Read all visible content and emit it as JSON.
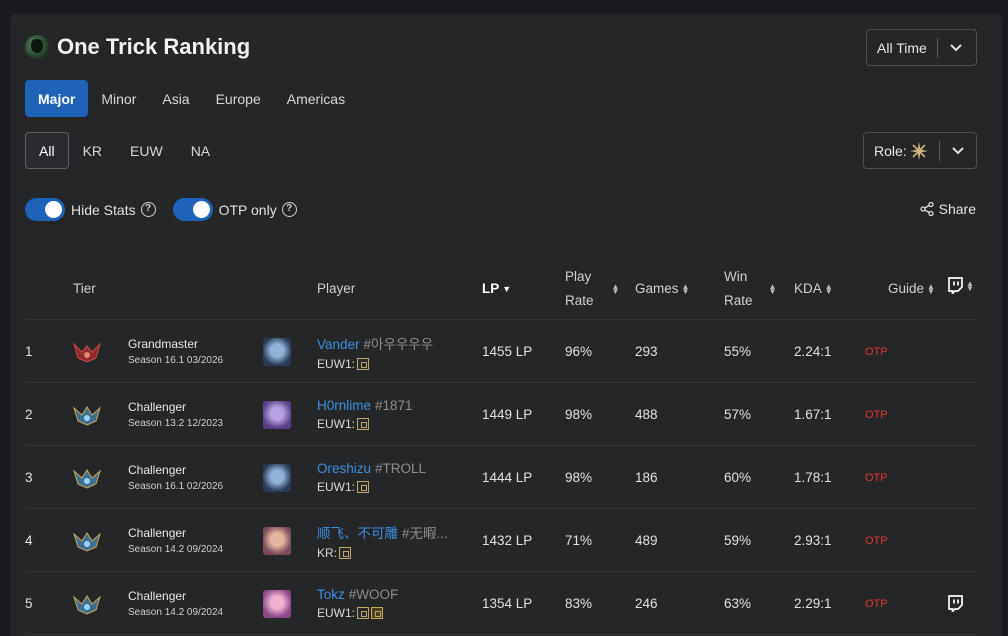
{
  "header": {
    "title": "One Trick Ranking",
    "time_filter": "All Time",
    "role_label": "Role:"
  },
  "tabs": [
    "Major",
    "Minor",
    "Asia",
    "Europe",
    "Americas"
  ],
  "regions": [
    "All",
    "KR",
    "EUW",
    "NA"
  ],
  "toggles": {
    "hide_stats": "Hide Stats",
    "otp_only": "OTP only"
  },
  "share": "Share",
  "columns": {
    "tier": "Tier",
    "player": "Player",
    "lp": "LP",
    "play_rate_1": "Play",
    "play_rate_2": "Rate",
    "games": "Games",
    "win_rate_1": "Win",
    "win_rate_2": "Rate",
    "kda": "KDA",
    "guide": "Guide"
  },
  "colors": {
    "accent": "#1f63b8",
    "link": "#3d8fe0",
    "otp": "#e23232"
  },
  "rows": [
    {
      "rank": "1",
      "tier": "Grandmaster",
      "season": "Season 16.1 03/2026",
      "name": "Vander",
      "tag": "#아우우우우",
      "server": "EUW1:",
      "lp": "1455 LP",
      "play_rate": "96%",
      "games": "293",
      "win_rate": "55%",
      "kda": "2.24:1",
      "otp": "OTP",
      "twitch": false
    },
    {
      "rank": "2",
      "tier": "Challenger",
      "season": "Season 13.2 12/2023",
      "name": "H0rnlime",
      "tag": "#1871",
      "server": "EUW1:",
      "lp": "1449 LP",
      "play_rate": "98%",
      "games": "488",
      "win_rate": "57%",
      "kda": "1.67:1",
      "otp": "OTP",
      "twitch": false
    },
    {
      "rank": "3",
      "tier": "Challenger",
      "season": "Season 16.1 02/2026",
      "name": "Oreshizu",
      "tag": "#TROLL",
      "server": "EUW1:",
      "lp": "1444 LP",
      "play_rate": "98%",
      "games": "186",
      "win_rate": "60%",
      "kda": "1.78:1",
      "otp": "OTP",
      "twitch": false
    },
    {
      "rank": "4",
      "tier": "Challenger",
      "season": "Season 14.2 09/2024",
      "name": "顺飞、不可雕",
      "tag": "#无暇...",
      "server": "KR:",
      "lp": "1432 LP",
      "play_rate": "71%",
      "games": "489",
      "win_rate": "59%",
      "kda": "2.93:1",
      "otp": "OTP",
      "twitch": false
    },
    {
      "rank": "5",
      "tier": "Challenger",
      "season": "Season 14.2 09/2024",
      "name": "Tokz",
      "tag": "#WOOF",
      "server": "EUW1:",
      "lp": "1354 LP",
      "play_rate": "83%",
      "games": "246",
      "win_rate": "63%",
      "kda": "2.29:1",
      "otp": "OTP",
      "twitch": true
    }
  ]
}
